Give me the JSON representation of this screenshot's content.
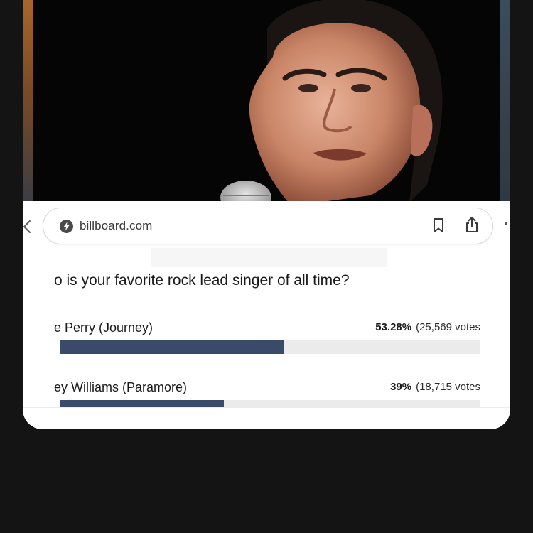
{
  "colors": {
    "background": "#141414",
    "accent_bar": "#3a4a6b",
    "bar_track": "#ebebeb"
  },
  "browser": {
    "url": "billboard.com",
    "site_icon": "bolt-icon",
    "bookmark_icon": "bookmark-icon",
    "share_icon": "share-icon",
    "back_icon": "chevron-left-icon",
    "more_icon": "more-icon"
  },
  "poll": {
    "question": "o is your favorite rock lead singer of all time?",
    "options": [
      {
        "name": "e Perry (Journey)",
        "percent_label": "53.28%",
        "votes_label": "(25,569 votes",
        "share": 0.5328
      },
      {
        "name": "ey Williams (Paramore)",
        "percent_label": "39%",
        "votes_label": "(18,715 votes",
        "share": 0.39
      }
    ]
  }
}
